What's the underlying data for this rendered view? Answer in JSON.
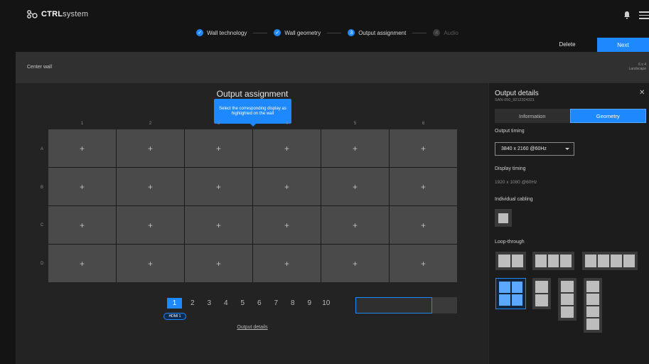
{
  "app": {
    "logo_bold": "CTRL",
    "logo_light": "system"
  },
  "steps": [
    {
      "label": "Wall technology",
      "icon": "check-icon",
      "state": "done"
    },
    {
      "label": "Wall geometry",
      "icon": "check-icon",
      "state": "done"
    },
    {
      "label": "Output assignment",
      "number": "3",
      "state": "active"
    },
    {
      "label": "Audio",
      "number": "4",
      "state": "inactive"
    }
  ],
  "actions": {
    "delete": "Delete",
    "next": "Next"
  },
  "wall": {
    "name": "Center wall",
    "size": "6 x 4",
    "orientation": "Landscape"
  },
  "main": {
    "title": "Output assignment",
    "tooltip": "Select the corresponding display as highlighted on the wall",
    "columns": [
      "1",
      "2",
      "3",
      "4",
      "5",
      "6"
    ],
    "rows": [
      "A",
      "B",
      "C",
      "D"
    ],
    "cell_icon": "plus-icon",
    "cell_symbol": "+",
    "pages": [
      "1",
      "2",
      "3",
      "4",
      "5",
      "6",
      "7",
      "8",
      "9",
      "10"
    ],
    "active_page": "1",
    "hdmi_badge": "HDMI 1",
    "output_details_link": "Output details"
  },
  "panel": {
    "title": "Output details",
    "serial": "SAN-050_9212324321",
    "tabs": [
      "Information",
      "Geometry"
    ],
    "active_tab": "Geometry",
    "output_timing_label": "Output timing",
    "output_timing_value": "3840 x 2160 @60Hz",
    "display_timing_label": "Display timing",
    "display_timing_value": "1920 x 1080 @60Hz",
    "individual_cabling_label": "Individual cabling",
    "loop_through_label": "Loop-through",
    "loop_through_options": [
      "2x1",
      "3x1",
      "4x1",
      "2x2",
      "1x2",
      "1x3",
      "1x4"
    ],
    "loop_through_selected": "2x2"
  },
  "colors": {
    "accent": "#1e88ff",
    "background": "#141414",
    "cell": "#4a4a4a"
  }
}
